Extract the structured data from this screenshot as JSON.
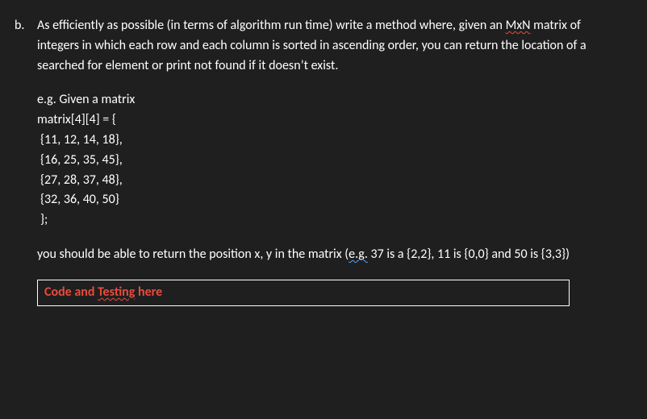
{
  "item_label": "b.",
  "prompt": {
    "pre1": "As efficiently as possible (in terms of algorithm run time) write a method where, given an ",
    "mxn": "MxN",
    "post1": " matrix of integers in which each row and each column is sorted in ascending order, you can return the location of a searched for element or print not found if it ",
    "doesnt": "doesn’t",
    "post2": " exist."
  },
  "example": {
    "intro": "e.g.  Given a matrix",
    "decl": "matrix[4][4] = {",
    "rows": [
      "{11, 12, 14, 18},",
      "{16, 25, 35, 45},",
      "{27, 28, 37, 48},",
      "{32, 36, 40, 50}"
    ],
    "close": "};"
  },
  "explain": {
    "pre": "you should be able to return the position x, y in the matrix (",
    "eg": "e.g.",
    "post": " 37 is a {2,2}, 11 is {0,0} and 50 is {3,3})"
  },
  "codebox": {
    "pre": "Code and ",
    "testing": "Testing",
    "post": " here"
  }
}
